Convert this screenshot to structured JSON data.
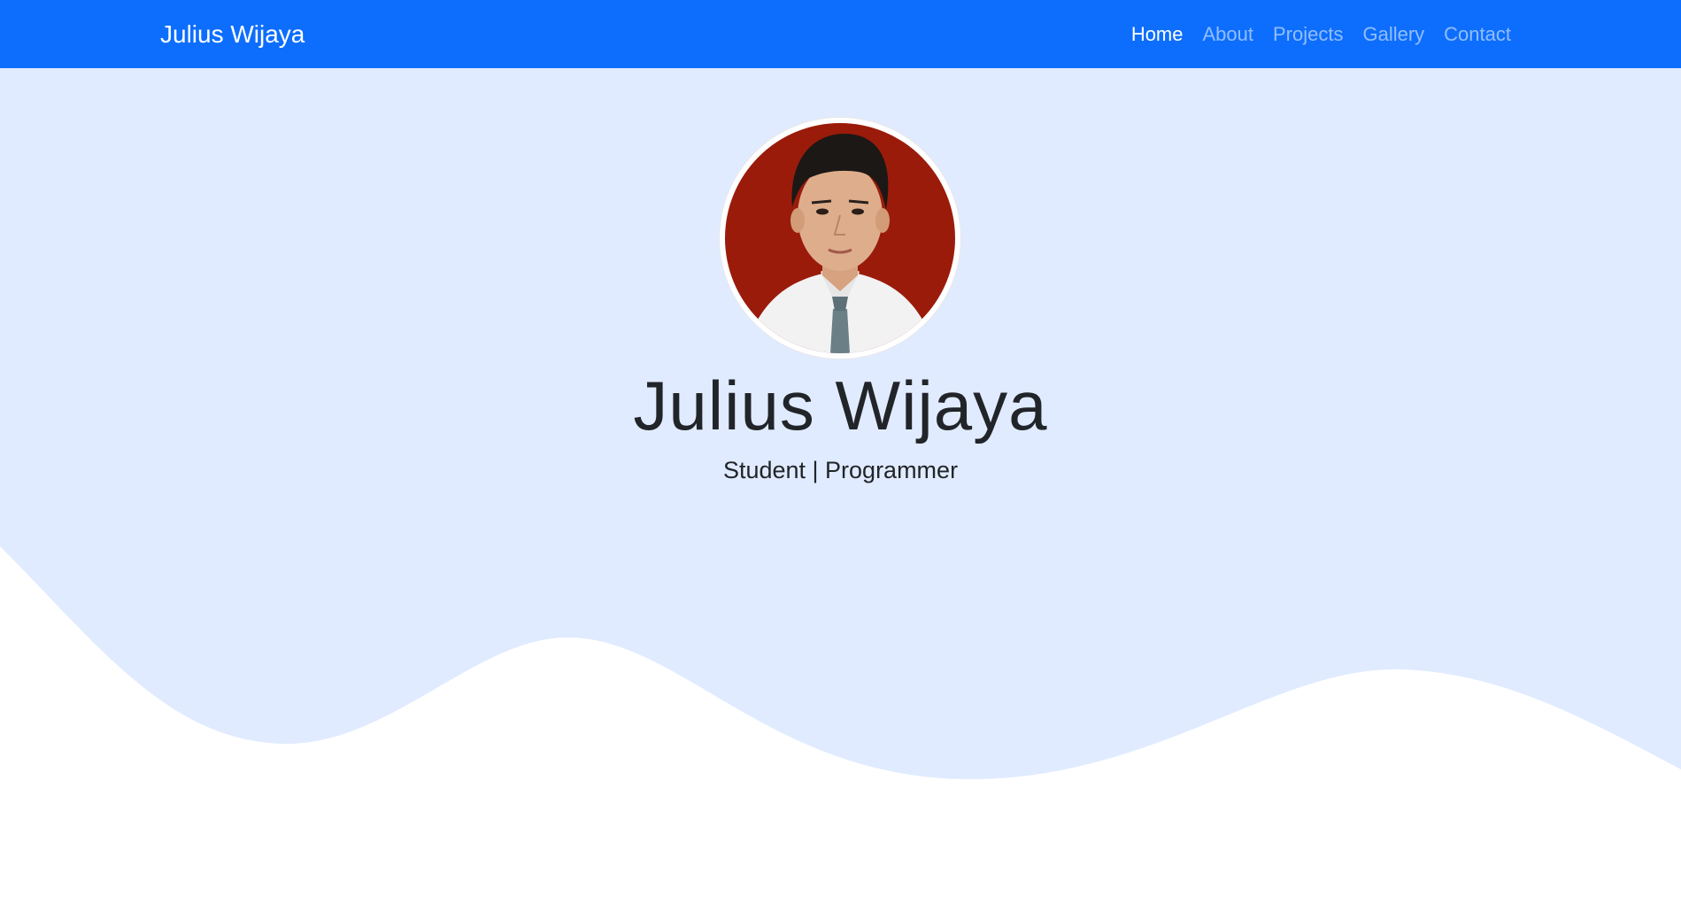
{
  "navbar": {
    "brand": "Julius Wijaya",
    "links": [
      {
        "label": "Home",
        "active": true
      },
      {
        "label": "About",
        "active": false
      },
      {
        "label": "Projects",
        "active": false
      },
      {
        "label": "Gallery",
        "active": false
      },
      {
        "label": "Contact",
        "active": false
      }
    ],
    "background": "#0d6efd"
  },
  "hero": {
    "name": "Julius Wijaya",
    "subtitle": "Student | Programmer",
    "background": "#e0ebff",
    "wave_color": "#ffffff",
    "avatar": {
      "icon": "profile-photo",
      "background_color": "#9b1b0a"
    }
  }
}
